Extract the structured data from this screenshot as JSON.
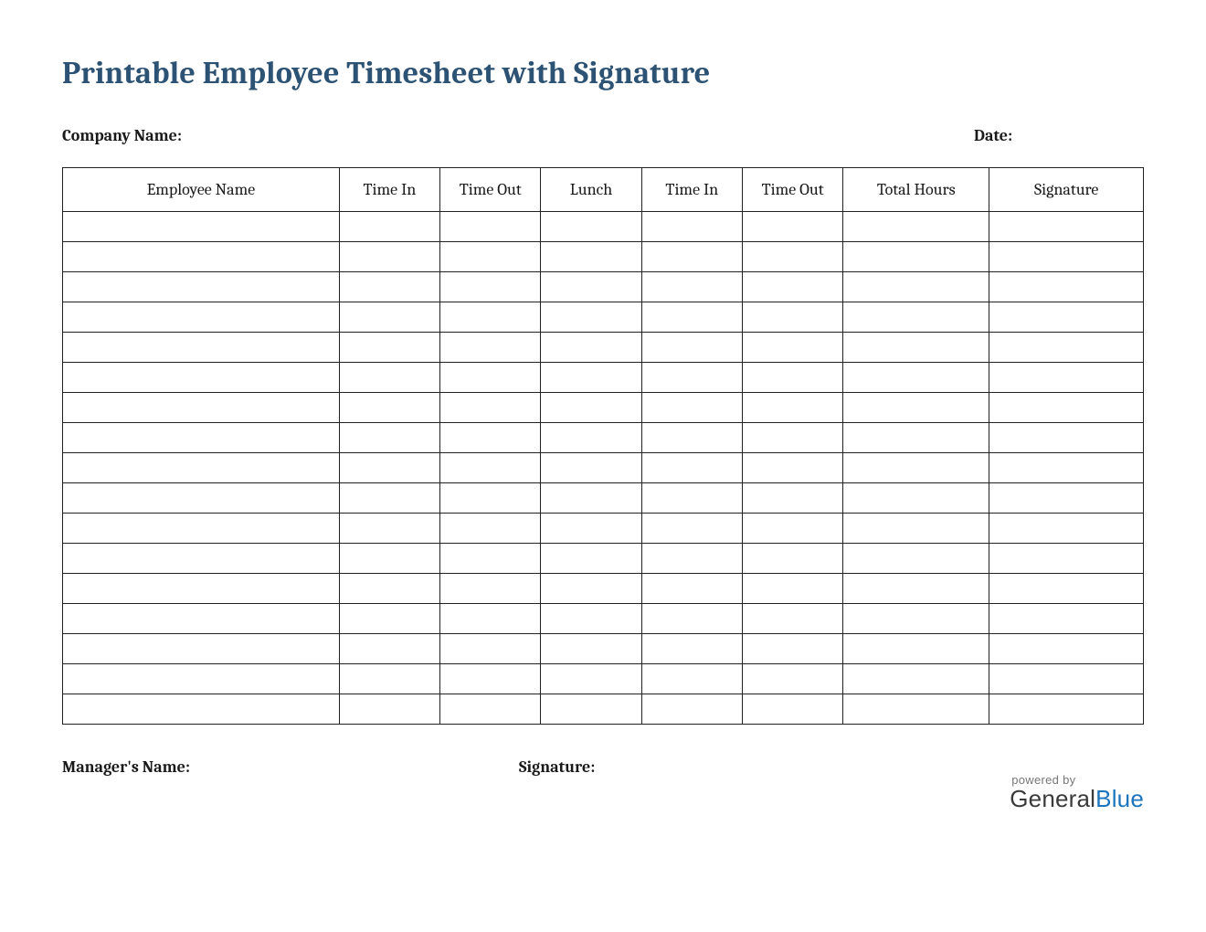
{
  "title": "Printable Employee Timesheet with Signature",
  "meta": {
    "company_label": "Company Name:",
    "date_label": "Date:"
  },
  "table": {
    "headers": [
      "Employee Name",
      "Time In",
      "Time Out",
      "Lunch",
      "Time In",
      "Time Out",
      "Total Hours",
      "Signature"
    ],
    "row_count": 17
  },
  "footer": {
    "manager_label": "Manager's Name:",
    "signature_label": "Signature:"
  },
  "brand": {
    "powered_by": "powered by",
    "name_a": "General",
    "name_b": "Blue"
  }
}
